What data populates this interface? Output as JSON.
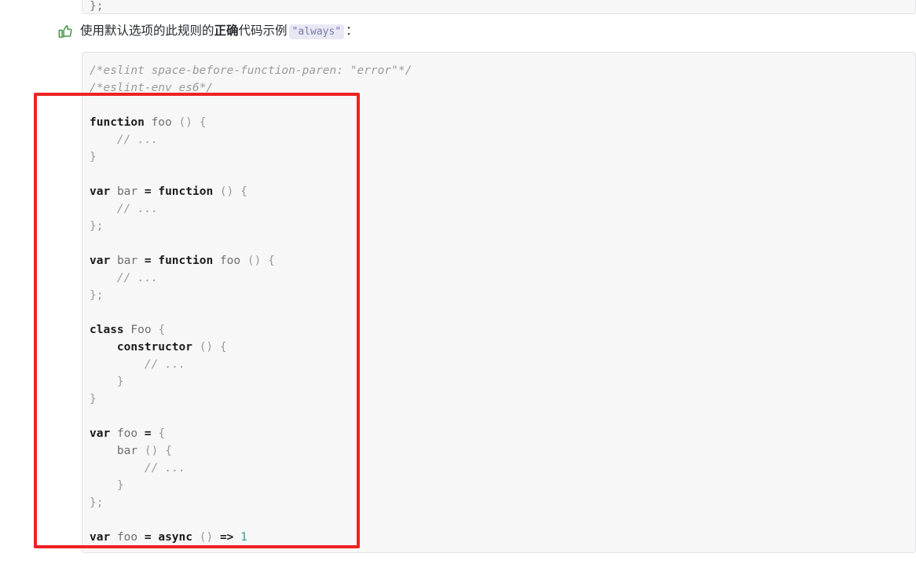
{
  "caption": {
    "icon": "thumbs-up-icon",
    "icon_color": "#3f9142",
    "text_before": "使用默认选项的此规则的",
    "text_bold": "正确",
    "text_after": "代码示例",
    "inline_code": "\"always\"",
    "text_end": "："
  },
  "top_code_block": {
    "line1": "    }",
    "line2": "};"
  },
  "code_block": {
    "language": "javascript",
    "lines": [
      {
        "segments": [
          {
            "t": "/*eslint space-before-function-paren: \"error\"*/",
            "c": "cm"
          }
        ]
      },
      {
        "segments": [
          {
            "t": "/*eslint-env es6*/",
            "c": "cm"
          }
        ]
      },
      {
        "segments": [
          {
            "t": "",
            "c": "p"
          }
        ]
      },
      {
        "segments": [
          {
            "t": "function",
            "c": "k"
          },
          {
            "t": " ",
            "c": "p"
          },
          {
            "t": "foo",
            "c": "id"
          },
          {
            "t": " ",
            "c": "p"
          },
          {
            "t": "()",
            "c": "p"
          },
          {
            "t": " ",
            "c": "p"
          },
          {
            "t": "{",
            "c": "p"
          }
        ]
      },
      {
        "segments": [
          {
            "t": "    ",
            "c": "p"
          },
          {
            "t": "// ...",
            "c": "cm"
          }
        ]
      },
      {
        "segments": [
          {
            "t": "}",
            "c": "p"
          }
        ]
      },
      {
        "segments": [
          {
            "t": "",
            "c": "p"
          }
        ]
      },
      {
        "segments": [
          {
            "t": "var",
            "c": "k"
          },
          {
            "t": " ",
            "c": "p"
          },
          {
            "t": "bar",
            "c": "id"
          },
          {
            "t": " ",
            "c": "p"
          },
          {
            "t": "=",
            "c": "op"
          },
          {
            "t": " ",
            "c": "p"
          },
          {
            "t": "function",
            "c": "k"
          },
          {
            "t": " ",
            "c": "p"
          },
          {
            "t": "()",
            "c": "p"
          },
          {
            "t": " ",
            "c": "p"
          },
          {
            "t": "{",
            "c": "p"
          }
        ]
      },
      {
        "segments": [
          {
            "t": "    ",
            "c": "p"
          },
          {
            "t": "// ...",
            "c": "cm"
          }
        ]
      },
      {
        "segments": [
          {
            "t": "};",
            "c": "p"
          }
        ]
      },
      {
        "segments": [
          {
            "t": "",
            "c": "p"
          }
        ]
      },
      {
        "segments": [
          {
            "t": "var",
            "c": "k"
          },
          {
            "t": " ",
            "c": "p"
          },
          {
            "t": "bar",
            "c": "id"
          },
          {
            "t": " ",
            "c": "p"
          },
          {
            "t": "=",
            "c": "op"
          },
          {
            "t": " ",
            "c": "p"
          },
          {
            "t": "function",
            "c": "k"
          },
          {
            "t": " ",
            "c": "p"
          },
          {
            "t": "foo",
            "c": "id"
          },
          {
            "t": " ",
            "c": "p"
          },
          {
            "t": "()",
            "c": "p"
          },
          {
            "t": " ",
            "c": "p"
          },
          {
            "t": "{",
            "c": "p"
          }
        ]
      },
      {
        "segments": [
          {
            "t": "    ",
            "c": "p"
          },
          {
            "t": "// ...",
            "c": "cm"
          }
        ]
      },
      {
        "segments": [
          {
            "t": "};",
            "c": "p"
          }
        ]
      },
      {
        "segments": [
          {
            "t": "",
            "c": "p"
          }
        ]
      },
      {
        "segments": [
          {
            "t": "class",
            "c": "k"
          },
          {
            "t": " ",
            "c": "p"
          },
          {
            "t": "Foo",
            "c": "id"
          },
          {
            "t": " ",
            "c": "p"
          },
          {
            "t": "{",
            "c": "p"
          }
        ]
      },
      {
        "segments": [
          {
            "t": "    ",
            "c": "p"
          },
          {
            "t": "constructor",
            "c": "k"
          },
          {
            "t": " ",
            "c": "p"
          },
          {
            "t": "()",
            "c": "p"
          },
          {
            "t": " ",
            "c": "p"
          },
          {
            "t": "{",
            "c": "p"
          }
        ]
      },
      {
        "segments": [
          {
            "t": "        ",
            "c": "p"
          },
          {
            "t": "// ...",
            "c": "cm"
          }
        ]
      },
      {
        "segments": [
          {
            "t": "    }",
            "c": "p"
          }
        ]
      },
      {
        "segments": [
          {
            "t": "}",
            "c": "p"
          }
        ]
      },
      {
        "segments": [
          {
            "t": "",
            "c": "p"
          }
        ]
      },
      {
        "segments": [
          {
            "t": "var",
            "c": "k"
          },
          {
            "t": " ",
            "c": "p"
          },
          {
            "t": "foo",
            "c": "id"
          },
          {
            "t": " ",
            "c": "p"
          },
          {
            "t": "=",
            "c": "op"
          },
          {
            "t": " ",
            "c": "p"
          },
          {
            "t": "{",
            "c": "p"
          }
        ]
      },
      {
        "segments": [
          {
            "t": "    ",
            "c": "p"
          },
          {
            "t": "bar",
            "c": "id"
          },
          {
            "t": " ",
            "c": "p"
          },
          {
            "t": "()",
            "c": "p"
          },
          {
            "t": " ",
            "c": "p"
          },
          {
            "t": "{",
            "c": "p"
          }
        ]
      },
      {
        "segments": [
          {
            "t": "        ",
            "c": "p"
          },
          {
            "t": "// ...",
            "c": "cm"
          }
        ]
      },
      {
        "segments": [
          {
            "t": "    }",
            "c": "p"
          }
        ]
      },
      {
        "segments": [
          {
            "t": "};",
            "c": "p"
          }
        ]
      },
      {
        "segments": [
          {
            "t": "",
            "c": "p"
          }
        ]
      },
      {
        "segments": [
          {
            "t": "var",
            "c": "k"
          },
          {
            "t": " ",
            "c": "p"
          },
          {
            "t": "foo",
            "c": "id"
          },
          {
            "t": " ",
            "c": "p"
          },
          {
            "t": "=",
            "c": "op"
          },
          {
            "t": " ",
            "c": "p"
          },
          {
            "t": "async",
            "c": "k"
          },
          {
            "t": " ",
            "c": "p"
          },
          {
            "t": "()",
            "c": "p"
          },
          {
            "t": " ",
            "c": "p"
          },
          {
            "t": "=>",
            "c": "op"
          },
          {
            "t": " ",
            "c": "p"
          },
          {
            "t": "1",
            "c": "num"
          }
        ]
      }
    ]
  },
  "annotation": {
    "shape": "rectangle",
    "color": "#ee2222"
  }
}
